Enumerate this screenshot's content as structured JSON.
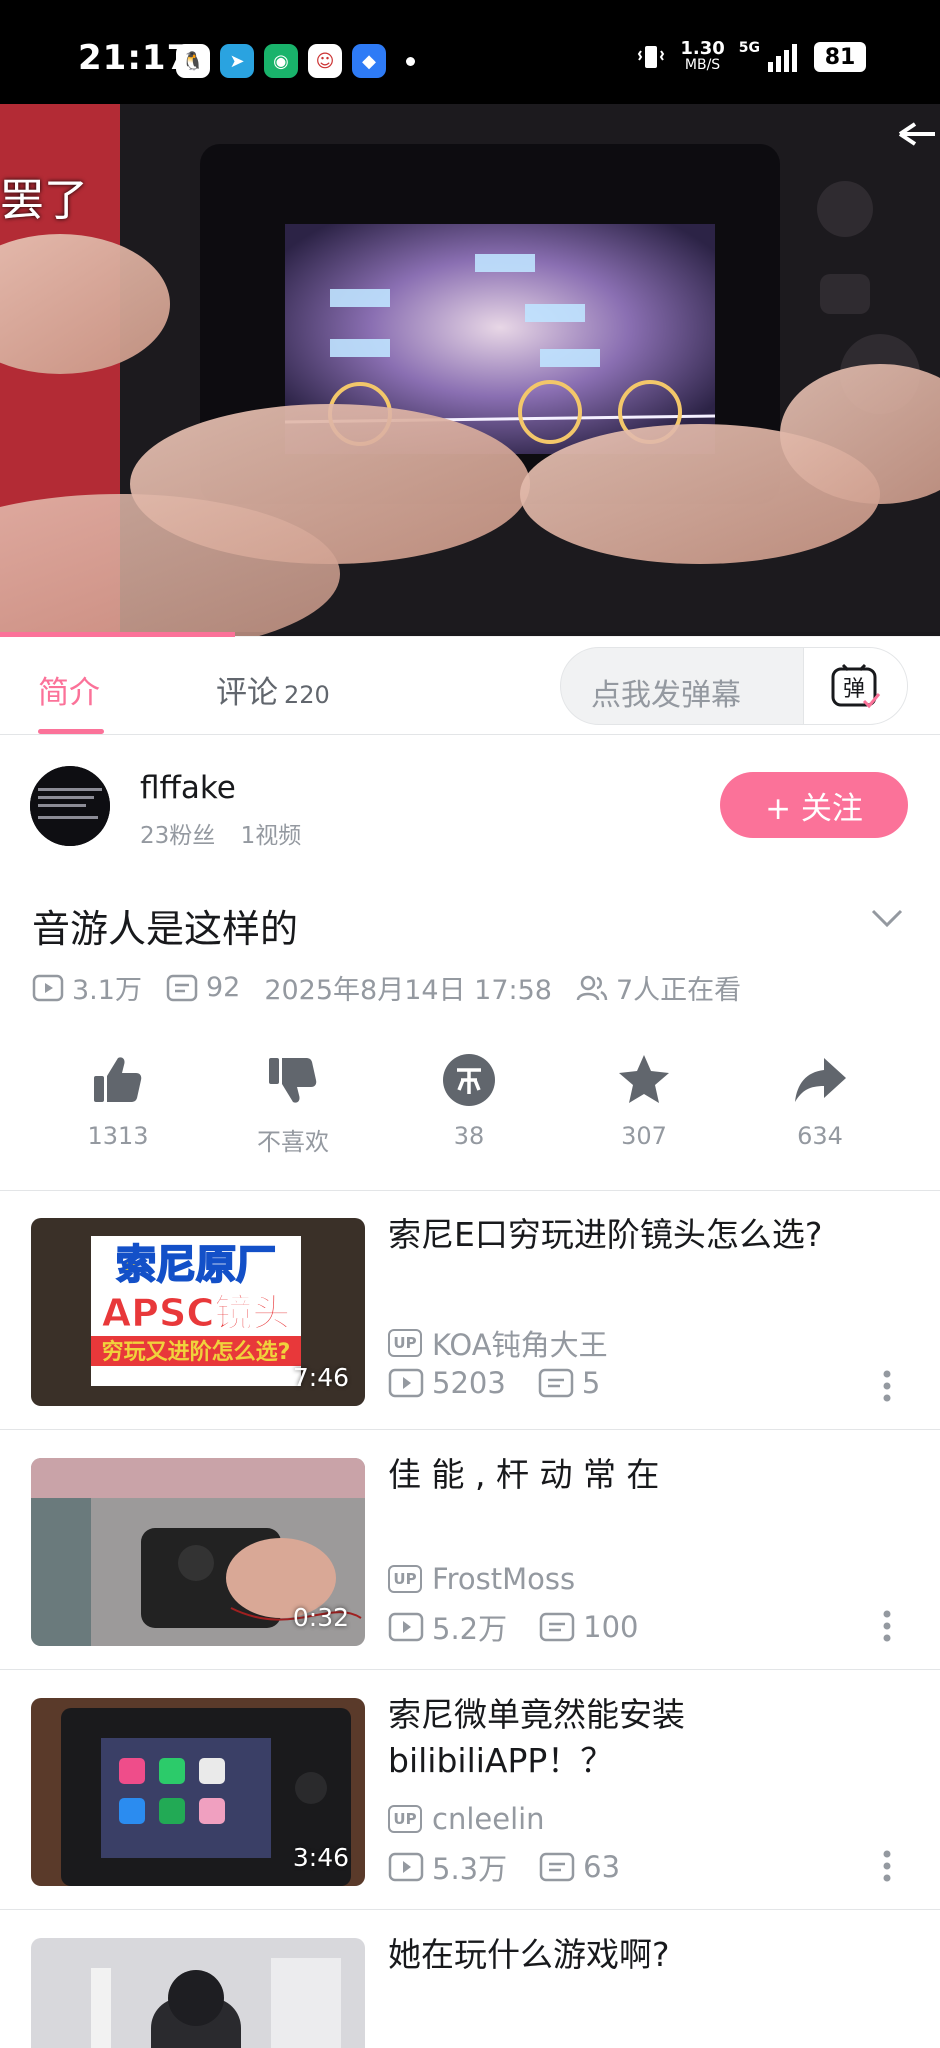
{
  "status_bar": {
    "time": "21:17",
    "speed_value": "1.30",
    "speed_unit": "MB/S",
    "network": "5G",
    "battery": "81"
  },
  "video": {
    "overlay_text": "罢了",
    "progress": 0.25
  },
  "tabs": {
    "intro": "简介",
    "comments": "评论",
    "comments_count": "220",
    "danmaku_placeholder": "点我发弹幕",
    "danmaku_button": "弹"
  },
  "uploader": {
    "name": "flffake",
    "fans": "23粉丝",
    "videos": "1视频",
    "follow_label": "+ 关注"
  },
  "video_info": {
    "title": "音游人是这样的",
    "views": "3.1万",
    "danmaku_count": "92",
    "date": "2025年8月14日 17:58",
    "watching": "7人正在看"
  },
  "actions": {
    "like": "1313",
    "dislike": "不喜欢",
    "coin": "38",
    "favorite": "307",
    "share": "634"
  },
  "related": [
    {
      "title": "索尼E口穷玩进阶镜头怎么选?",
      "duration": "7:46",
      "uploader": "KOA钝角大王",
      "views": "5203",
      "danmaku": "5",
      "thumb_text_1": "索尼原厂",
      "thumb_text_2": "APSC镜头",
      "thumb_text_3": "穷玩又进阶怎么选?"
    },
    {
      "title": "佳 能 , 杆 动 常 在",
      "duration": "0:32",
      "uploader": "FrostMoss",
      "views": "5.2万",
      "danmaku": "100"
    },
    {
      "title": "索尼微单竟然能安装bilibiliAPP！？",
      "duration": "3:46",
      "uploader": "cnleelin",
      "views": "5.3万",
      "danmaku": "63"
    },
    {
      "title": "她在玩什么游戏啊?"
    }
  ],
  "up_badge": "UP",
  "colors": {
    "accent": "#fb7299",
    "text": "#18191c",
    "muted": "#9499a0"
  }
}
